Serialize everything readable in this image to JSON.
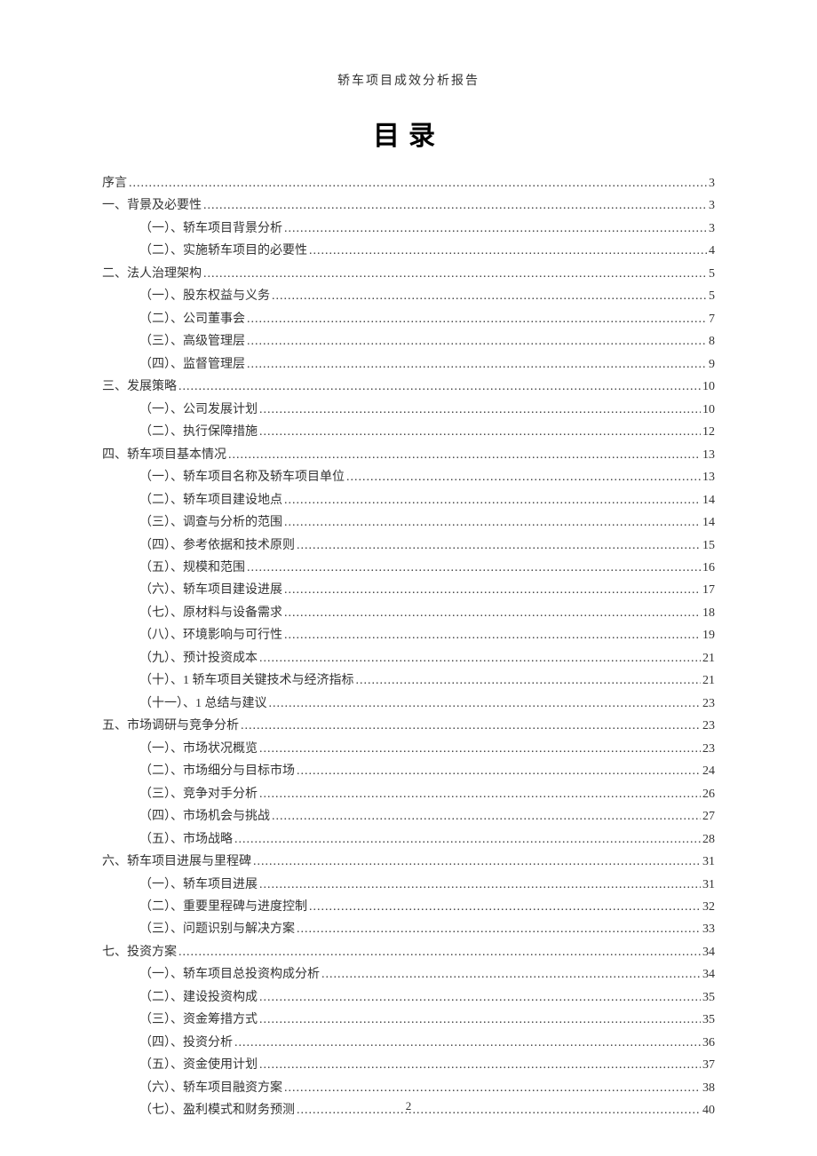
{
  "header": "轿车项目成效分析报告",
  "title": "目录",
  "page_number": "2",
  "toc": [
    {
      "level": 1,
      "label": "序言",
      "page": "3"
    },
    {
      "level": 1,
      "label": "一、背景及必要性",
      "page": "3"
    },
    {
      "level": 2,
      "label": "（一）、轿车项目背景分析",
      "page": "3"
    },
    {
      "level": 2,
      "label": "（二）、实施轿车项目的必要性",
      "page": "4"
    },
    {
      "level": 1,
      "label": "二、法人治理架构",
      "page": "5"
    },
    {
      "level": 2,
      "label": "（一）、股东权益与义务",
      "page": "5"
    },
    {
      "level": 2,
      "label": "（二）、公司董事会",
      "page": "7"
    },
    {
      "level": 2,
      "label": "（三）、高级管理层",
      "page": "8"
    },
    {
      "level": 2,
      "label": "（四）、监督管理层",
      "page": "9"
    },
    {
      "level": 1,
      "label": "三、发展策略",
      "page": "10"
    },
    {
      "level": 2,
      "label": "（一）、公司发展计划",
      "page": "10"
    },
    {
      "level": 2,
      "label": "（二）、执行保障措施",
      "page": "12"
    },
    {
      "level": 1,
      "label": "四、轿车项目基本情况",
      "page": "13"
    },
    {
      "level": 2,
      "label": "（一）、轿车项目名称及轿车项目单位",
      "page": "13"
    },
    {
      "level": 2,
      "label": "（二）、轿车项目建设地点",
      "page": "14"
    },
    {
      "level": 2,
      "label": "（三）、调查与分析的范围",
      "page": "14"
    },
    {
      "level": 2,
      "label": "（四）、参考依据和技术原则",
      "page": "15"
    },
    {
      "level": 2,
      "label": "（五）、规模和范围",
      "page": "16"
    },
    {
      "level": 2,
      "label": "（六）、轿车项目建设进展",
      "page": "17"
    },
    {
      "level": 2,
      "label": "（七）、原材料与设备需求",
      "page": "18"
    },
    {
      "level": 2,
      "label": "（八）、环境影响与可行性",
      "page": "19"
    },
    {
      "level": 2,
      "label": "（九）、预计投资成本",
      "page": "21"
    },
    {
      "level": 2,
      "label": "（十）、1 轿车项目关键技术与经济指标",
      "page": "21"
    },
    {
      "level": 2,
      "label": "（十一）、1 总结与建议",
      "page": "23"
    },
    {
      "level": 1,
      "label": "五、市场调研与竞争分析",
      "page": "23"
    },
    {
      "level": 2,
      "label": "（一）、市场状况概览",
      "page": "23"
    },
    {
      "level": 2,
      "label": "（二）、市场细分与目标市场",
      "page": "24"
    },
    {
      "level": 2,
      "label": "（三）、竞争对手分析",
      "page": "26"
    },
    {
      "level": 2,
      "label": "（四）、市场机会与挑战",
      "page": "27"
    },
    {
      "level": 2,
      "label": "（五）、市场战略",
      "page": "28"
    },
    {
      "level": 1,
      "label": "六、轿车项目进展与里程碑",
      "page": "31"
    },
    {
      "level": 2,
      "label": "（一）、轿车项目进展",
      "page": "31"
    },
    {
      "level": 2,
      "label": "（二）、重要里程碑与进度控制",
      "page": "32"
    },
    {
      "level": 2,
      "label": "（三）、问题识别与解决方案",
      "page": "33"
    },
    {
      "level": 1,
      "label": "七、投资方案",
      "page": "34"
    },
    {
      "level": 2,
      "label": "（一）、轿车项目总投资构成分析",
      "page": "34"
    },
    {
      "level": 2,
      "label": "（二）、建设投资构成",
      "page": "35"
    },
    {
      "level": 2,
      "label": "（三）、资金筹措方式",
      "page": "35"
    },
    {
      "level": 2,
      "label": "（四）、投资分析",
      "page": "36"
    },
    {
      "level": 2,
      "label": "（五）、资金使用计划",
      "page": "37"
    },
    {
      "level": 2,
      "label": "（六）、轿车项目融资方案",
      "page": "38"
    },
    {
      "level": 2,
      "label": "（七）、盈利模式和财务预测",
      "page": "40"
    }
  ]
}
